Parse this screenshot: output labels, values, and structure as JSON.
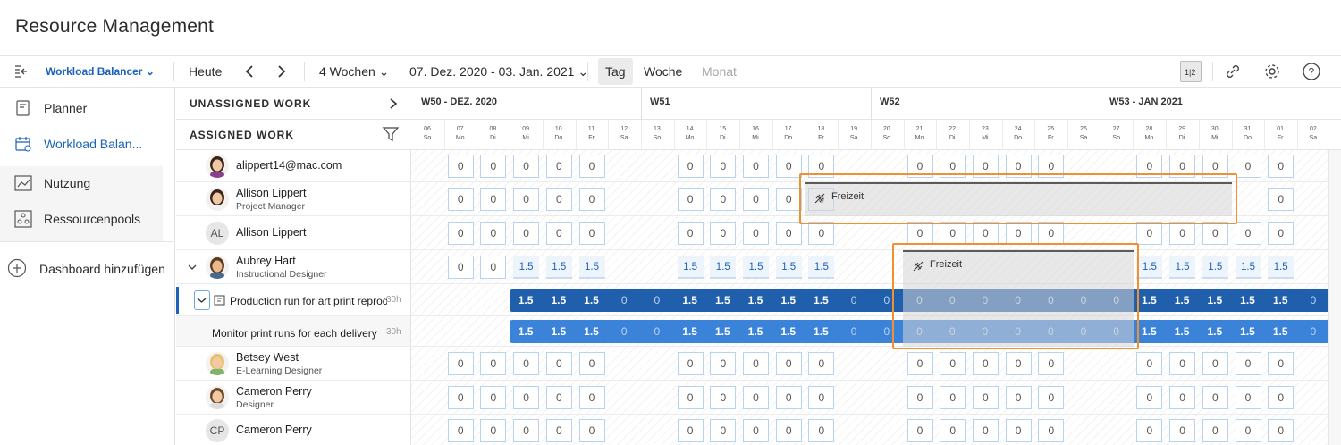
{
  "app": {
    "title": "Resource Management"
  },
  "toolbar": {
    "view_selector": "Workload Balancer",
    "today": "Heute",
    "range": "4 Wochen",
    "dates": "07. Dez. 2020 - 03. Jan. 2021",
    "views": [
      "Tag",
      "Woche",
      "Monat"
    ],
    "active_view": "Tag",
    "icons": [
      "collapse-sidebar-icon",
      "prev-arrow-icon",
      "next-arrow-icon",
      "split-view-icon",
      "link-icon",
      "gear-icon",
      "help-icon"
    ]
  },
  "sidebar": {
    "items": [
      {
        "label": "Planner",
        "icon": "planner-icon",
        "active": false
      },
      {
        "label": "Workload Balan...",
        "icon": "calendar-icon",
        "active": true
      },
      {
        "label": "Nutzung",
        "icon": "chart-icon",
        "active": false
      },
      {
        "label": "Ressourcenpools",
        "icon": "pools-icon",
        "active": false
      }
    ],
    "add_dashboard": "Dashboard hinzufügen"
  },
  "panel": {
    "unassigned": "UNASSIGNED WORK",
    "assigned": "ASSIGNED WORK"
  },
  "weeks": [
    "W50 - DEZ. 2020",
    "W51",
    "W52",
    "W53 - JAN 2021"
  ],
  "days": [
    {
      "d": "06",
      "w": "So"
    },
    {
      "d": "07",
      "w": "Mo"
    },
    {
      "d": "08",
      "w": "Di"
    },
    {
      "d": "09",
      "w": "Mi"
    },
    {
      "d": "10",
      "w": "Do"
    },
    {
      "d": "11",
      "w": "Fr"
    },
    {
      "d": "12",
      "w": "Sa"
    },
    {
      "d": "13",
      "w": "So"
    },
    {
      "d": "14",
      "w": "Mo"
    },
    {
      "d": "15",
      "w": "Di"
    },
    {
      "d": "16",
      "w": "Mi"
    },
    {
      "d": "17",
      "w": "Do"
    },
    {
      "d": "18",
      "w": "Fr"
    },
    {
      "d": "19",
      "w": "Sa"
    },
    {
      "d": "20",
      "w": "So"
    },
    {
      "d": "21",
      "w": "Mo"
    },
    {
      "d": "22",
      "w": "Di"
    },
    {
      "d": "23",
      "w": "Mi"
    },
    {
      "d": "24",
      "w": "Do"
    },
    {
      "d": "25",
      "w": "Fr"
    },
    {
      "d": "26",
      "w": "Sa"
    },
    {
      "d": "27",
      "w": "So"
    },
    {
      "d": "28",
      "w": "Mo"
    },
    {
      "d": "29",
      "w": "Di"
    },
    {
      "d": "30",
      "w": "Mi"
    },
    {
      "d": "31",
      "w": "Do"
    },
    {
      "d": "01",
      "w": "Fr"
    },
    {
      "d": "02",
      "w": "Sa"
    }
  ],
  "people": [
    {
      "name": "alippert14@mac.com",
      "role": "",
      "initials": "",
      "cells": [
        "",
        "0",
        "0",
        "0",
        "0",
        "0",
        "",
        "",
        "0",
        "0",
        "0",
        "0",
        "0",
        "",
        "",
        "0",
        "0",
        "0",
        "0",
        "0",
        "",
        "",
        "0",
        "0",
        "0",
        "0",
        "0",
        ""
      ]
    },
    {
      "name": "Allison Lippert",
      "role": "Project Manager",
      "initials": "",
      "cells": [
        "",
        "0",
        "0",
        "0",
        "0",
        "0",
        "",
        "",
        "0",
        "0",
        "0",
        "0",
        "0",
        "",
        "",
        "",
        "",
        "",
        "",
        "",
        "",
        "",
        "",
        "",
        "",
        "",
        "0",
        ""
      ],
      "timeoff": "Freizeit"
    },
    {
      "name": "Allison Lippert",
      "role": "",
      "initials": "AL",
      "cells": [
        "",
        "0",
        "0",
        "0",
        "0",
        "0",
        "",
        "",
        "0",
        "0",
        "0",
        "0",
        "0",
        "",
        "",
        "0",
        "0",
        "0",
        "0",
        "0",
        "",
        "",
        "0",
        "0",
        "0",
        "0",
        "0",
        ""
      ]
    },
    {
      "name": "Aubrey Hart",
      "role": "Instructional Designer",
      "initials": "",
      "cells": [
        "",
        "0",
        "0",
        "1.5",
        "1.5",
        "1.5",
        "",
        "",
        "1.5",
        "1.5",
        "1.5",
        "1.5",
        "1.5",
        "",
        "",
        "",
        "",
        "",
        "",
        "",
        "",
        "",
        "1.5",
        "1.5",
        "1.5",
        "1.5",
        "1.5",
        ""
      ],
      "timeoff": "Freizeit"
    },
    {
      "name": "Betsey West",
      "role": "E-Learning Designer",
      "initials": "",
      "cells": [
        "",
        "0",
        "0",
        "0",
        "0",
        "0",
        "",
        "",
        "0",
        "0",
        "0",
        "0",
        "0",
        "",
        "",
        "0",
        "0",
        "0",
        "0",
        "0",
        "",
        "",
        "0",
        "0",
        "0",
        "0",
        "0",
        ""
      ]
    },
    {
      "name": "Cameron Perry",
      "role": "Designer",
      "initials": "",
      "cells": [
        "",
        "0",
        "0",
        "0",
        "0",
        "0",
        "",
        "",
        "0",
        "0",
        "0",
        "0",
        "0",
        "",
        "",
        "0",
        "0",
        "0",
        "0",
        "0",
        "",
        "",
        "0",
        "0",
        "0",
        "0",
        "0",
        ""
      ]
    },
    {
      "name": "Cameron Perry",
      "role": "",
      "initials": "CP",
      "cells": [
        "",
        "0",
        "0",
        "0",
        "0",
        "0",
        "",
        "",
        "0",
        "0",
        "0",
        "0",
        "0",
        "",
        "",
        "0",
        "0",
        "0",
        "0",
        "0",
        "",
        "",
        "0",
        "0",
        "0",
        "0",
        "0",
        ""
      ]
    }
  ],
  "tasks": [
    {
      "name": "Production run for art print reproduction",
      "hours": "30h",
      "values": [
        "1.5",
        "1.5",
        "1.5",
        "0",
        "0",
        "1.5",
        "1.5",
        "1.5",
        "1.5",
        "1.5",
        "0",
        "0",
        "0",
        "0",
        "0",
        "0",
        "0",
        "0",
        "0",
        "1.5",
        "1.5",
        "1.5",
        "1.5",
        "1.5",
        "0"
      ],
      "color": "#1f5fab"
    },
    {
      "name": "Monitor print runs for each delivery",
      "hours": "30h",
      "values": [
        "1.5",
        "1.5",
        "1.5",
        "0",
        "0",
        "1.5",
        "1.5",
        "1.5",
        "1.5",
        "1.5",
        "0",
        "0",
        "0",
        "0",
        "0",
        "0",
        "0",
        "0",
        "0",
        "1.5",
        "1.5",
        "1.5",
        "1.5",
        "1.5",
        "0"
      ],
      "color": "#3b82d9"
    }
  ],
  "colors": {
    "accent": "#1b62b8",
    "highlight": "#f0902e",
    "bar_dark": "#1f5fab",
    "bar_light": "#3b82d9"
  }
}
